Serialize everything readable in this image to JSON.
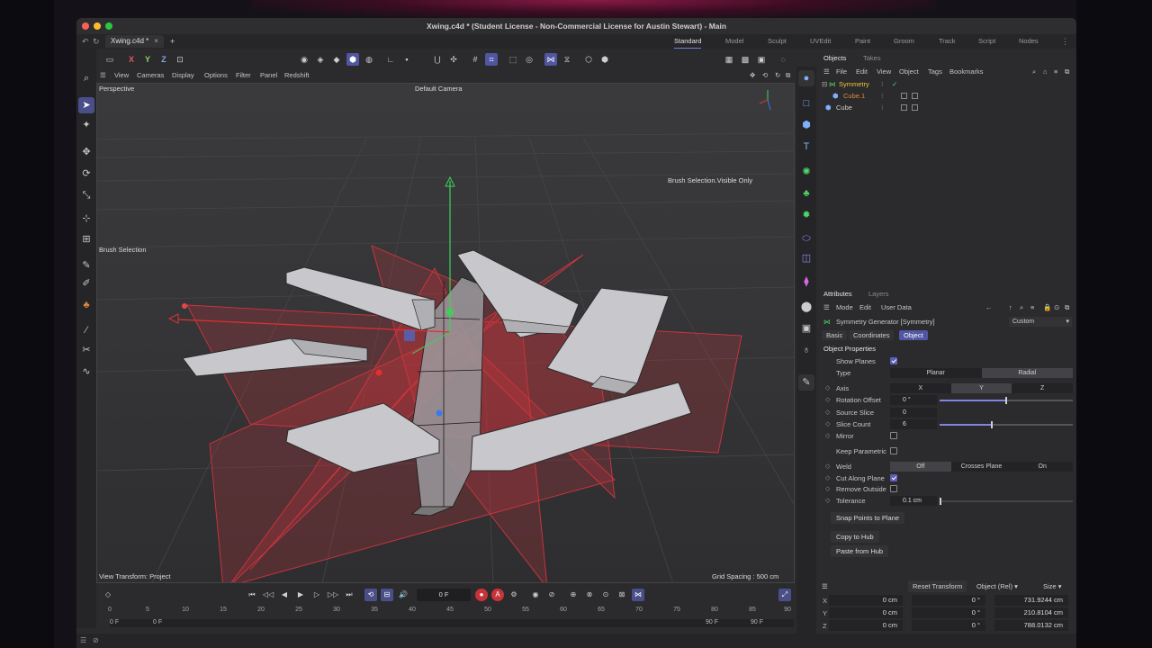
{
  "window": {
    "title": "Xwing.c4d * (Student License - Non-Commercial License for Austin Stewart) - Main"
  },
  "tabs": {
    "doc": "Xwing.c4d *",
    "close": "×",
    "add": "+"
  },
  "workspaces": [
    "Standard",
    "Model",
    "Sculpt",
    "UVEdit",
    "Paint",
    "Groom",
    "Track",
    "Script",
    "Nodes"
  ],
  "toolbar": {
    "x": "X",
    "y": "Y",
    "z": "Z"
  },
  "viewport_menu": [
    "View",
    "Cameras",
    "Display",
    "Options",
    "Filter",
    "Panel",
    "Redshift"
  ],
  "viewport": {
    "name": "Perspective",
    "camera": "Default Camera",
    "brush_visible": "Brush Selection.Visible Only",
    "brush_selection": "Brush Selection",
    "view_transform": "View Transform: Project",
    "grid_spacing": "Grid Spacing : 500 cm"
  },
  "timeline": {
    "current_frame": "0 F",
    "ruler": [
      "0",
      "5",
      "10",
      "15",
      "20",
      "25",
      "30",
      "35",
      "40",
      "45",
      "50",
      "55",
      "60",
      "65",
      "70",
      "75",
      "80",
      "85",
      "90"
    ],
    "range_start": "0 F",
    "range_start2": "0 F",
    "range_end": "90 F",
    "range_end2": "90 F"
  },
  "objects_panel": {
    "tabs": [
      "Objects",
      "Takes"
    ],
    "menu": [
      "File",
      "Edit",
      "View",
      "Object",
      "Tags",
      "Bookmarks"
    ],
    "items": [
      {
        "name": "Symmetry",
        "color": "#f0c23a"
      },
      {
        "name": "Cube.1",
        "color": "#e0883a"
      },
      {
        "name": "Cube",
        "color": "#cfcfcf"
      }
    ]
  },
  "attributes": {
    "tabs": [
      "Attributes",
      "Layers"
    ],
    "menu": [
      "Mode",
      "Edit",
      "User Data"
    ],
    "object_title": "Symmetry Generator [Symmetry]",
    "preset": "Custom",
    "subtabs": [
      "Basic",
      "Coordinates",
      "Object"
    ],
    "section": "Object Properties",
    "show_planes": "Show Planes",
    "type_label": "Type",
    "type_options": [
      "Planar",
      "Radial"
    ],
    "axis_label": "Axis",
    "axis_options": [
      "X",
      "Y",
      "Z"
    ],
    "rotation_offset_label": "Rotation Offset",
    "rotation_offset": "0 °",
    "source_slice_label": "Source Slice",
    "source_slice": "0",
    "slice_count_label": "Slice Count",
    "slice_count": "6",
    "mirror_label": "Mirror",
    "keep_parametric_label": "Keep Parametric",
    "weld_label": "Weld",
    "weld_options": [
      "Off",
      "Crosses Plane",
      "On"
    ],
    "cut_along_plane_label": "Cut Along Plane",
    "remove_outside_label": "Remove Outside",
    "tolerance_label": "Tolerance",
    "tolerance": "0.1 cm",
    "snap_button": "Snap Points to Plane",
    "copy_button": "Copy to Hub",
    "paste_button": "Paste from Hub"
  },
  "coordinates": {
    "reset": "Reset Transform",
    "mode": "Object (Rel)",
    "size": "Size",
    "rows": [
      {
        "axis": "X",
        "pos": "0 cm",
        "rot": "0 °",
        "size": "731.9244 cm"
      },
      {
        "axis": "Y",
        "pos": "0 cm",
        "rot": "0 °",
        "size": "210.8104 cm"
      },
      {
        "axis": "Z",
        "pos": "0 cm",
        "rot": "0 °",
        "size": "788.0132 cm"
      }
    ]
  },
  "colors": {
    "accent": "#5056a0",
    "plane": "#c8323c",
    "axis_green": "#3ed15a",
    "axis_red": "#e03030"
  }
}
